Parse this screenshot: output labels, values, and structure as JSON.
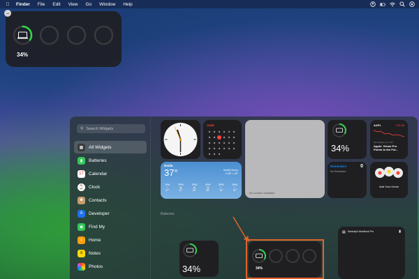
{
  "menubar": {
    "app": "Finder",
    "items": [
      "File",
      "Edit",
      "View",
      "Go",
      "Window",
      "Help"
    ]
  },
  "desktop_widget": {
    "percentage": "34%",
    "charge": 0.34
  },
  "gallery": {
    "search_placeholder": "Search Widgets",
    "sidebar": [
      {
        "label": "All Widgets",
        "icon": "all-widgets-icon",
        "color": "#3a3a3c"
      },
      {
        "label": "Batteries",
        "icon": "batteries-icon",
        "color": "#34c759"
      },
      {
        "label": "Calendar",
        "icon": "calendar-icon",
        "color": "#ffffff"
      },
      {
        "label": "Clock",
        "icon": "clock-icon",
        "color": "#ffffff"
      },
      {
        "label": "Contacts",
        "icon": "contacts-icon",
        "color": "#c69c6d"
      },
      {
        "label": "Developer",
        "icon": "developer-icon",
        "color": "#1e6ff0"
      },
      {
        "label": "Find My",
        "icon": "find-my-icon",
        "color": "#34c759"
      },
      {
        "label": "Home",
        "icon": "home-icon",
        "color": "#ff9f0a"
      },
      {
        "label": "Notes",
        "icon": "notes-icon",
        "color": "#ffd60a"
      },
      {
        "label": "Photos",
        "icon": "photos-icon",
        "color": "#ffffff"
      }
    ],
    "weather": {
      "city": "Noida",
      "temp": "37°",
      "condition": "Mostly Sunny",
      "range": "H:38° L:28°",
      "hours": [
        "1PM",
        "2PM",
        "3PM",
        "4PM",
        "5PM",
        "6PM"
      ],
      "temps": [
        "37°",
        "37°",
        "36°",
        "35°",
        "33°",
        "32°"
      ]
    },
    "calendar": {
      "month": "JUNE"
    },
    "battery_tile": {
      "percentage": "34%",
      "charge": 0.34
    },
    "stock": {
      "symbol": "AAPL",
      "price": "176.55",
      "source": "Morningstar, Inc. 16h",
      "headline": "Apple: Vision Pro Points to the Fut..."
    },
    "reminders": {
      "title": "Reminders",
      "count": "0",
      "subtitle": "No Reminders"
    },
    "home": {
      "label": "Add Your Home"
    },
    "no_content": "No content available",
    "section_label": "Batteries",
    "small_battery": {
      "percentage": "34%",
      "charge": 0.34
    },
    "medium_battery": {
      "percentage": "34%",
      "charge": 0.34
    },
    "large_battery": {
      "title": "Sankalp's MacBook Pro"
    }
  },
  "colors": {
    "battery_ring": "#32d74b",
    "highlight": "#e2642a"
  }
}
